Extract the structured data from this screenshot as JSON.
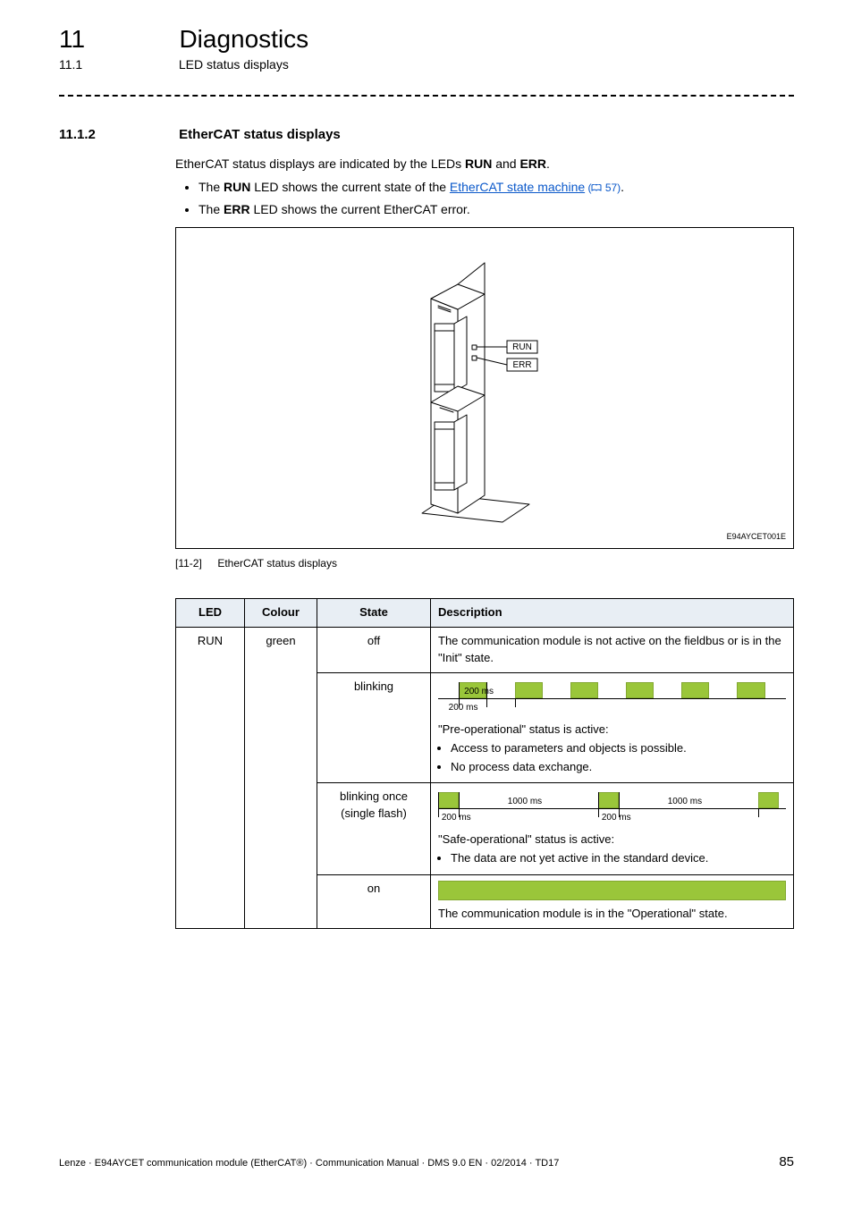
{
  "header": {
    "chapter_num": "11",
    "chapter_title": "Diagnostics",
    "sub_num": "11.1",
    "sub_title": "LED status displays"
  },
  "section": {
    "num": "11.1.2",
    "title": "EtherCAT status displays"
  },
  "intro": {
    "line1_pre": "EtherCAT status displays are indicated by the LEDs ",
    "line1_b1": "RUN",
    "line1_mid": " and ",
    "line1_b2": "ERR",
    "line1_post": ".",
    "bullet1_pre": "The ",
    "bullet1_b": "RUN",
    "bullet1_mid": " LED shows the current state of the ",
    "bullet1_link": "EtherCAT state machine",
    "bullet1_ref": " 57)",
    "bullet1_ref_open": " (",
    "bullet1_post": ".",
    "bullet2_pre": "The ",
    "bullet2_b": "ERR",
    "bullet2_post": " LED shows the current EtherCAT error."
  },
  "figure": {
    "run_label": "RUN",
    "err_label": "ERR",
    "code": "E94AYCET001E",
    "caption_num": "[11-2]",
    "caption_text": "EtherCAT status displays"
  },
  "table": {
    "headers": {
      "led": "LED",
      "colour": "Colour",
      "state": "State",
      "description": "Description"
    },
    "rows": {
      "run_led": "RUN",
      "run_colour": "green",
      "off_state": "off",
      "off_desc": "The communication module is not active on the fieldbus or is in the \"Init\" state.",
      "blinking_state": "blinking",
      "blinking_top_label": "200 ms",
      "blinking_bottom_label": "200 ms",
      "blinking_desc_line": "\"Pre-operational\" status is active:",
      "blinking_desc_b1": "Access to parameters and objects is possible.",
      "blinking_desc_b2": "No process data exchange.",
      "single_state_l1": "blinking once",
      "single_state_l2": "(single flash)",
      "single_top_label1": "1000 ms",
      "single_top_label2": "1000 ms",
      "single_bottom_label1": "200 ms",
      "single_bottom_label2": "200 ms",
      "single_desc_line": "\"Safe-operational\" status is active:",
      "single_desc_b1": "The data are not yet active in the standard device.",
      "on_state": "on",
      "on_desc": "The communication module is in the \"Operational\" state."
    }
  },
  "footer": {
    "text": "Lenze · E94AYCET communication module (EtherCAT®) · Communication Manual · DMS 9.0 EN · 02/2014 · TD17",
    "page": "85"
  },
  "chart_data": [
    {
      "type": "table",
      "title": "EtherCAT RUN LED status",
      "columns": [
        "LED",
        "Colour",
        "State",
        "Description"
      ],
      "rows": [
        [
          "RUN",
          "green",
          "off",
          "Not active on fieldbus / Init state"
        ],
        [
          "RUN",
          "green",
          "blinking (200ms on / 200ms off)",
          "Pre-operational: parameter access possible, no process data exchange"
        ],
        [
          "RUN",
          "green",
          "single flash (200ms on / 1000ms off)",
          "Safe-operational: data not yet active in standard device"
        ],
        [
          "RUN",
          "green",
          "on",
          "Operational state"
        ]
      ]
    }
  ]
}
